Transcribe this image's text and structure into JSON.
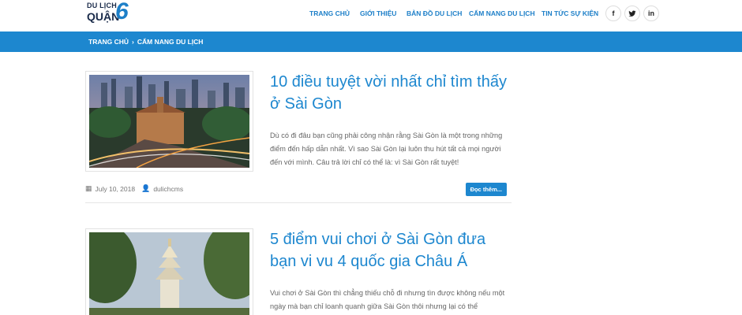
{
  "logo": {
    "top": "DU LỊCH",
    "bottom": "QUẬN",
    "number": "6"
  },
  "nav": [
    {
      "label": "TRANG CHỦ"
    },
    {
      "label": "GIỚI THIỆU"
    },
    {
      "label": "BẢN ĐỒ DU LỊCH"
    },
    {
      "label": "CẨM NANG DU LỊCH"
    },
    {
      "label": "TIN TỨC SỰ KIỆN"
    }
  ],
  "social": {
    "facebook": "f",
    "twitter": "🐦",
    "linkedin": "in"
  },
  "breadcrumb": {
    "home": "TRANG CHỦ",
    "separator": "›",
    "current": "CẨM NANG DU LỊCH"
  },
  "posts": [
    {
      "title": "10 điều tuyệt vời nhất chỉ tìm thấy ở Sài Gòn",
      "excerpt": "Dù có đi đâu bạn cũng phải công nhận rằng Sài Gòn là một trong những điểm đến hấp dẫn nhất. Vì sao Sài Gòn lại luôn thu hút tất cả mọi người đến với mình. Câu trả lời chỉ có thể là: vì Sài Gòn rất tuyệt!",
      "date": "July 10, 2018",
      "author": "dulichcms",
      "read_more": "Đọc thêm..."
    },
    {
      "title": "5 điểm vui chơi ở Sài Gòn đưa bạn vi vu 4 quốc gia Châu Á",
      "excerpt": "Vui chơi ở Sài Gòn thì chẳng thiếu chỗ đi nhưng tìn được không nếu một ngày mà bạn chỉ loanh quanh giữa Sài Gòn thôi nhưng lại có thể"
    }
  ],
  "colors": {
    "accent": "#1d87cf",
    "text": "#666666"
  }
}
